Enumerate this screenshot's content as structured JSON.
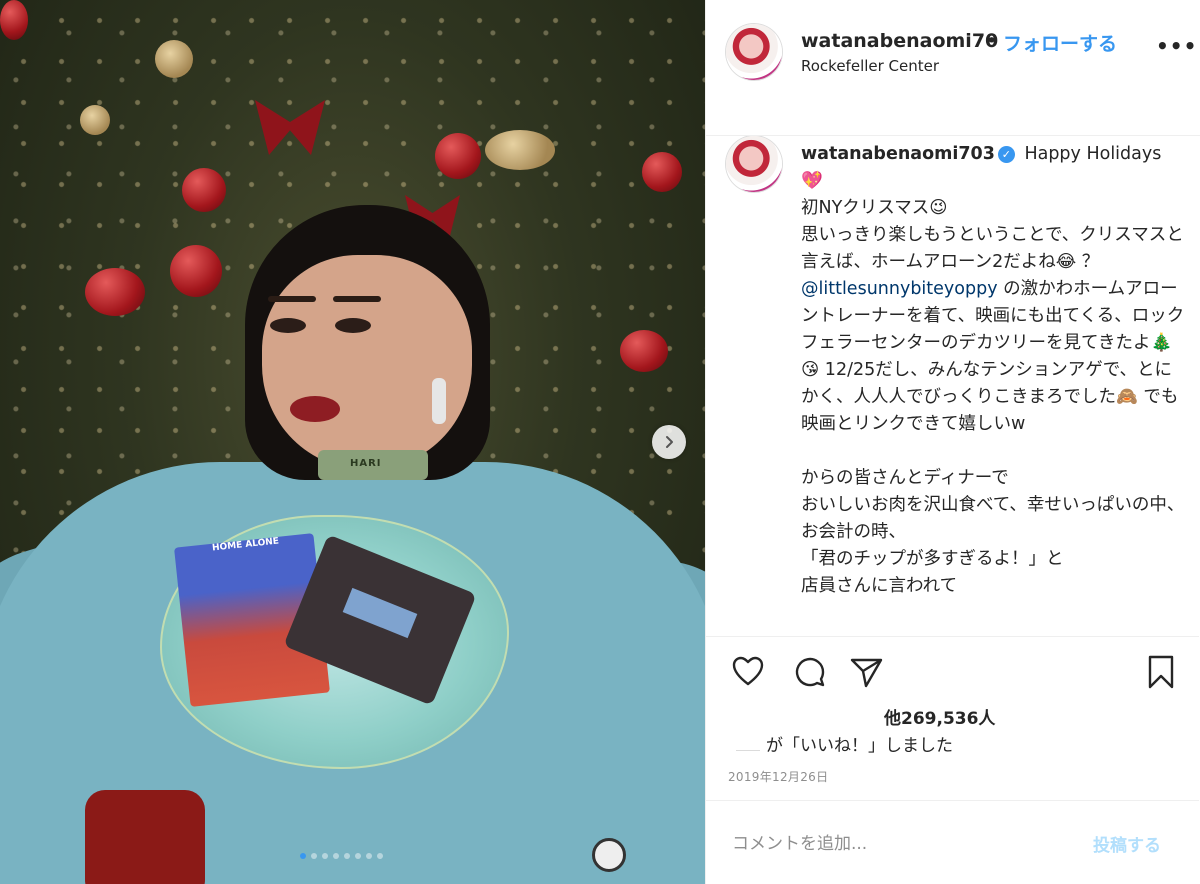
{
  "header": {
    "username": "watanabenaomi70",
    "separator": "•",
    "follow_label": "フォローする",
    "location": "Rockefeller Center",
    "more_label": "•••"
  },
  "photo": {
    "sweater_print": "HARI",
    "cover_title": "HOME ALONE",
    "carousel_dots": 8,
    "active_dot": 0
  },
  "caption": {
    "username": "watanabenaomi703",
    "verified_mark": "✓",
    "text_1": " Happy Holidays 💖\n初NYクリスマス😉\n思いっきり楽しもうということで、クリスマスと言えば、ホームアローン2だよね😂 ？\n",
    "mention": "@littlesunnybiteyoppy",
    "text_2": " の激かわホームアローントレーナーを着て、映画にも出てくる、ロックフェラーセンターのデカツリーを見てきたよ🎄😘 12/25だし、みんなテンションアゲで、とにかく、人人人でびっくりこきまろでした🙈 でも映画とリンクできて嬉しいw\n\nからの皆さんとディナーで\nおいしいお肉を沢山食べて、幸せいっぱいの中、お会計の時、\n「君のチップが多すぎるよ！」と\n店員さんに言われて"
  },
  "actions": {
    "like_icon": "heart-icon",
    "comment_icon": "comment-icon",
    "share_icon": "send-icon",
    "save_icon": "bookmark-icon"
  },
  "likes": {
    "count_text": "他269,536人",
    "liked_by_text": "が「いいね！」しました"
  },
  "date": "2019年12月26日",
  "comment": {
    "placeholder": "コメントを追加...",
    "post_label": "投稿する"
  },
  "colors": {
    "accent": "#3897f0",
    "post_disabled": "#b2dffc",
    "muted": "#8e8e8e",
    "text": "#262626"
  }
}
